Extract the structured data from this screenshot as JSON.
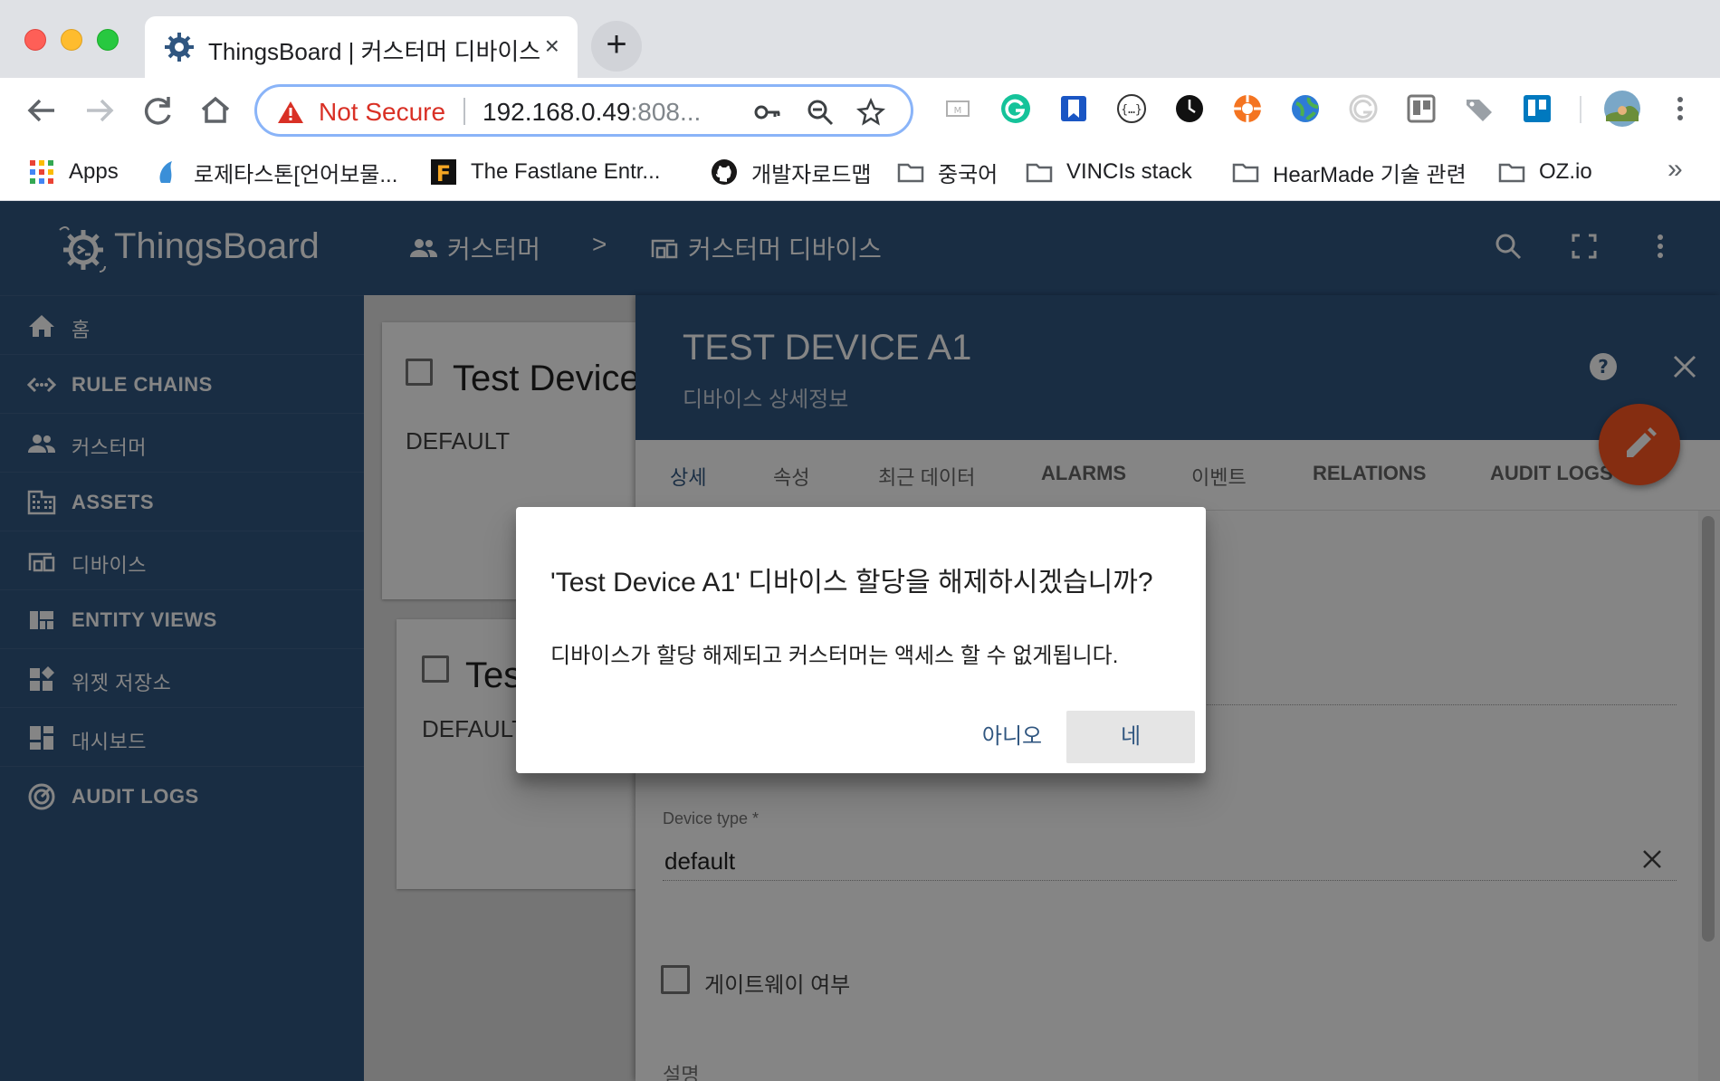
{
  "browser": {
    "tab_title": "ThingsBoard | 커스터머 디바이스",
    "tab_close": "×",
    "new_tab": "+",
    "security_label": "Not Secure",
    "url_host": "192.168.0.49",
    "url_rest": ":808...",
    "bookmarks": {
      "apps": "Apps",
      "b1": "로제타스톤[언어보물...",
      "b2": "The Fastlane Entr...",
      "b3": "개발자로드맵",
      "b4": "중국어",
      "b5": "VINCIs stack",
      "b6": "HearMade 기술 관련",
      "b7": "OZ.io",
      "more": "»"
    }
  },
  "brand": {
    "name": "ThingsBoard"
  },
  "sidebar": {
    "items": [
      {
        "label": "홈",
        "icon": "home-icon"
      },
      {
        "label": "RULE CHAINS",
        "icon": "code-arrows-icon"
      },
      {
        "label": "커스터머",
        "icon": "people-icon"
      },
      {
        "label": "ASSETS",
        "icon": "domain-icon"
      },
      {
        "label": "디바이스",
        "icon": "devices-icon"
      },
      {
        "label": "ENTITY VIEWS",
        "icon": "view-quilt-icon"
      },
      {
        "label": "위젯 저장소",
        "icon": "widgets-icon"
      },
      {
        "label": "대시보드",
        "icon": "dashboard-icon"
      },
      {
        "label": "AUDIT LOGS",
        "icon": "track-changes-icon"
      }
    ]
  },
  "breadcrumb": {
    "customers": "커스터머",
    "separator": ">",
    "customer_devices": "커스터머 디바이스"
  },
  "list": {
    "cards": [
      {
        "title": "Test Device",
        "type": "DEFAULT"
      },
      {
        "title": "Tes",
        "type": "DEFAULT"
      }
    ]
  },
  "detail": {
    "title": "TEST DEVICE A1",
    "subtitle": "디바이스 상세정보",
    "tabs": [
      "상세",
      "속성",
      "최근 데이터",
      "ALARMS",
      "이벤트",
      "RELATIONS",
      "AUDIT LOGS"
    ],
    "device_type_label": "Device type *",
    "device_type_value": "default",
    "gateway_label": "게이트웨이 여부",
    "description_label": "설명"
  },
  "dialog": {
    "title": "'Test Device A1' 디바이스 할당을 해제하시겠습니까?",
    "message": "디바이스가 할당 해제되고 커스터머는 액세스 할 수 없게됩니다.",
    "no_label": "아니오",
    "yes_label": "네"
  },
  "colors": {
    "primary": "#305680",
    "accent": "#ff5722",
    "warning": "#d93025"
  }
}
